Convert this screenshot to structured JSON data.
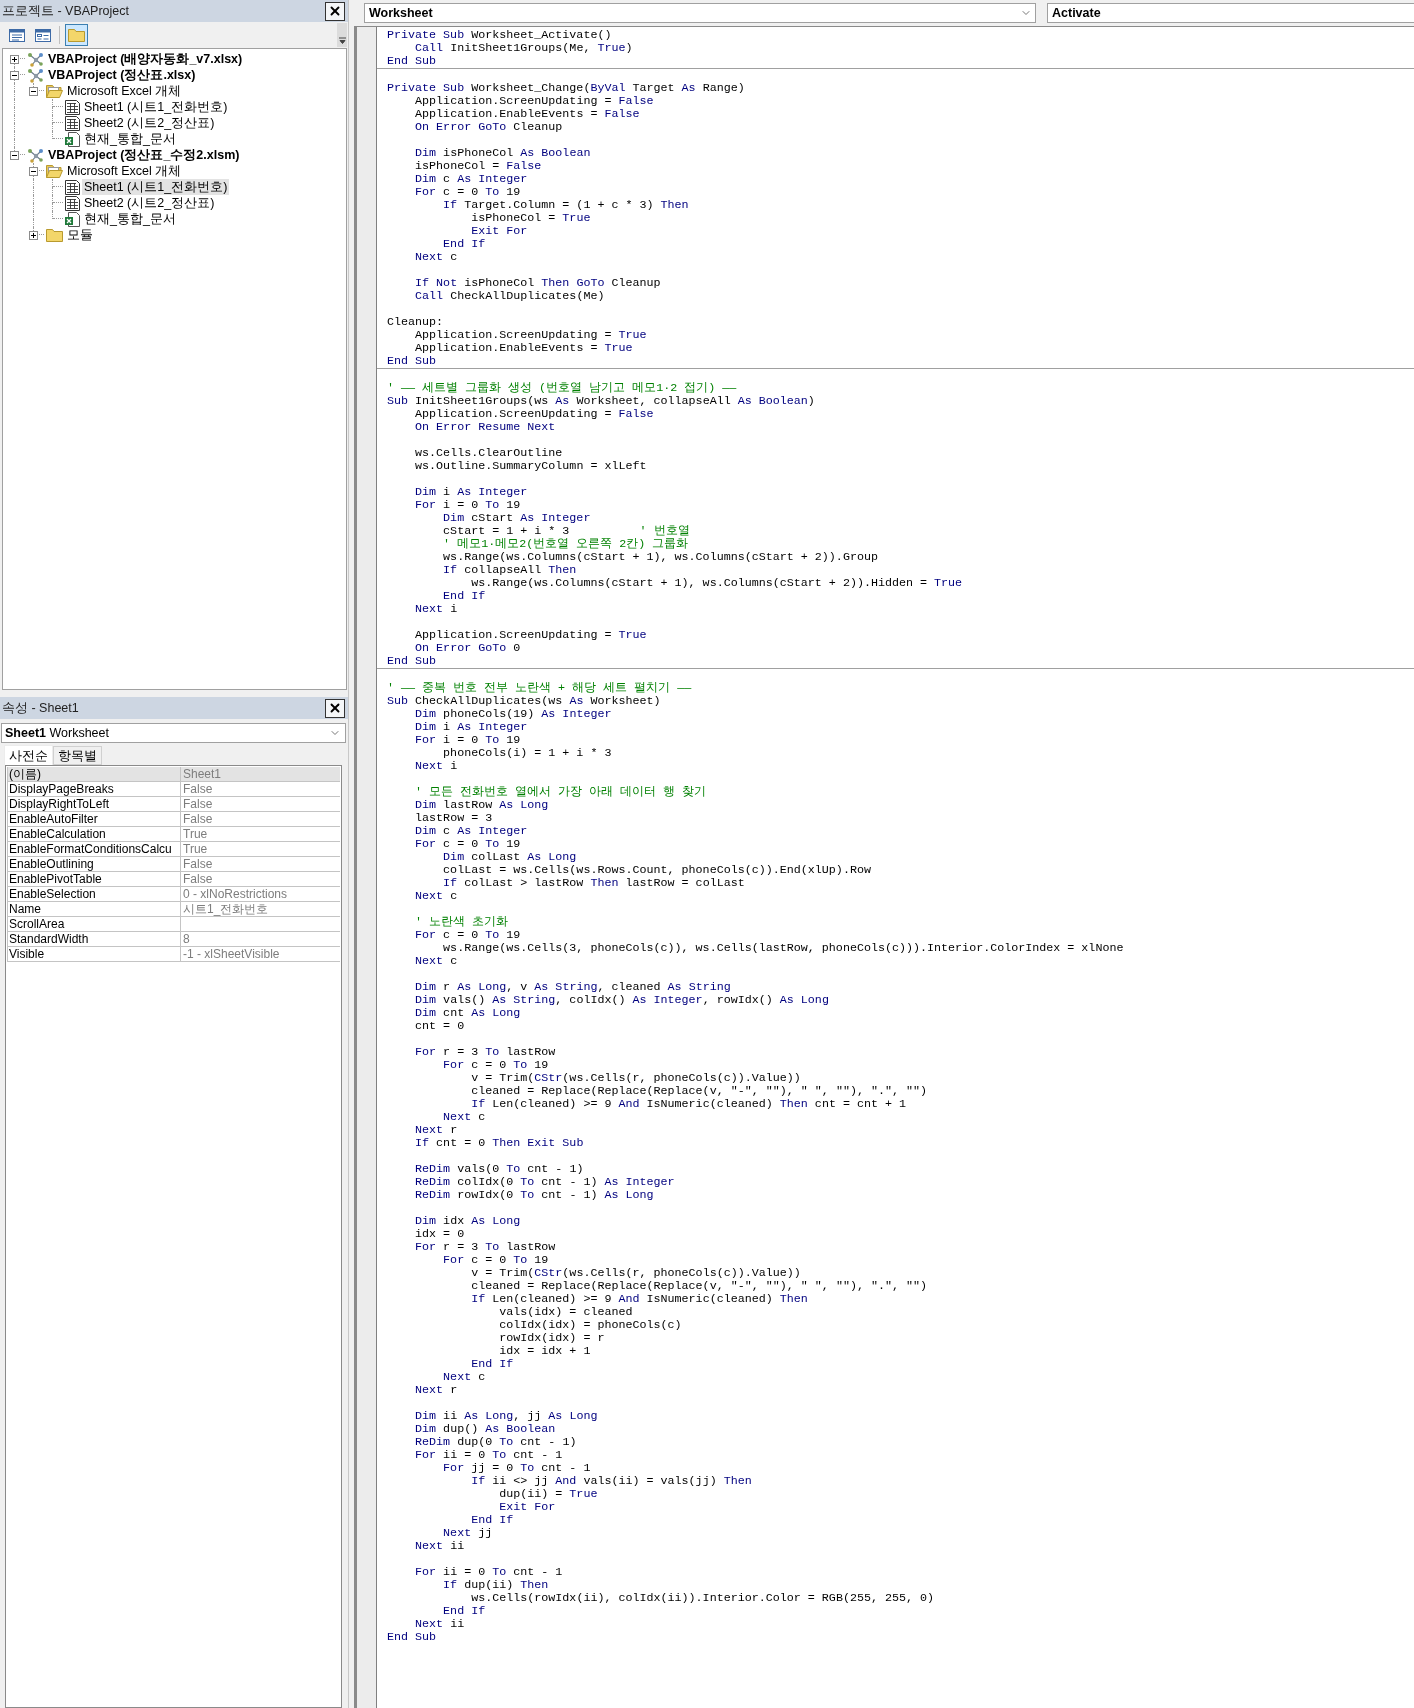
{
  "project_explorer": {
    "title": "프로젝트 - VBAProject",
    "toolbar": [
      {
        "kind": "view_code",
        "pressed": false
      },
      {
        "kind": "view_object",
        "pressed": false
      },
      {
        "kind": "toggle_folders",
        "pressed": true
      }
    ],
    "tree": [
      {
        "label": "VBAProject (배양자동화_v7.xlsx)",
        "kind": "project",
        "expanded": false,
        "selected": false
      },
      {
        "label": "VBAProject (정산표.xlsx)",
        "kind": "project",
        "expanded": true,
        "selected": false,
        "children": [
          {
            "label": "Microsoft Excel 개체",
            "kind": "folder",
            "expanded": true,
            "selected": false,
            "children": [
              {
                "label": "Sheet1 (시트1_전화번호)",
                "kind": "sheet",
                "selected": false
              },
              {
                "label": "Sheet2 (시트2_정산표)",
                "kind": "sheet",
                "selected": false
              },
              {
                "label": "현재_통합_문서",
                "kind": "workbook",
                "selected": false
              }
            ]
          }
        ]
      },
      {
        "label": "VBAProject (정산표_수정2.xlsm)",
        "kind": "project",
        "expanded": true,
        "selected": false,
        "children": [
          {
            "label": "Microsoft Excel 개체",
            "kind": "folder",
            "expanded": true,
            "selected": false,
            "children": [
              {
                "label": "Sheet1 (시트1_전화번호)",
                "kind": "sheet",
                "selected": true
              },
              {
                "label": "Sheet2 (시트2_정산표)",
                "kind": "sheet",
                "selected": false
              },
              {
                "label": "현재_통합_문서",
                "kind": "workbook",
                "selected": false
              }
            ]
          },
          {
            "label": "모듈",
            "kind": "folder",
            "expanded": false,
            "selected": false
          }
        ]
      }
    ]
  },
  "properties": {
    "title": "속성 - Sheet1",
    "object": {
      "name": "Sheet1",
      "type": "Worksheet"
    },
    "tabs": [
      {
        "label": "사전순",
        "selected": true
      },
      {
        "label": "항목별",
        "selected": false
      }
    ],
    "rows": [
      {
        "name": "(이름)",
        "value": "Sheet1",
        "selected": true
      },
      {
        "name": "DisplayPageBreaks",
        "value": "False",
        "selected": false
      },
      {
        "name": "DisplayRightToLeft",
        "value": "False",
        "selected": false
      },
      {
        "name": "EnableAutoFilter",
        "value": "False",
        "selected": false
      },
      {
        "name": "EnableCalculation",
        "value": "True",
        "selected": false
      },
      {
        "name": "EnableFormatConditionsCalcu",
        "value": "True",
        "selected": false
      },
      {
        "name": "EnableOutlining",
        "value": "False",
        "selected": false
      },
      {
        "name": "EnablePivotTable",
        "value": "False",
        "selected": false
      },
      {
        "name": "EnableSelection",
        "value": "0 - xlNoRestrictions",
        "selected": false
      },
      {
        "name": "Name",
        "value": "시트1_전화번호",
        "selected": false
      },
      {
        "name": "ScrollArea",
        "selected": false
      },
      {
        "name": "StandardWidth",
        "value": "8",
        "selected": false
      },
      {
        "name": "Visible",
        "value": "-1 - xlSheetVisible",
        "selected": false
      }
    ]
  },
  "code_window": {
    "object_box": "Worksheet",
    "procedure_box": "Activate",
    "procedures": [
      {
        "blocks": [
          [
            [
              {
                "kind": "keyword",
                "text": "Private Sub"
              },
              {
                "kind": "plain",
                "text": " Worksheet_Activate()"
              }
            ],
            [
              {
                "kind": "keyword",
                "text": "    Call"
              },
              {
                "kind": "plain",
                "text": " InitSheet1Groups(Me, "
              },
              {
                "kind": "keyword",
                "text": "True"
              },
              {
                "kind": "plain",
                "text": ")"
              }
            ],
            [
              {
                "kind": "keyword",
                "text": "End Sub"
              }
            ]
          ]
        ]
      },
      {
        "blocks": [
          [
            [
              {
                "kind": "keyword",
                "text": "Private Sub"
              },
              {
                "kind": "plain",
                "text": " Worksheet_Change("
              },
              {
                "kind": "keyword",
                "text": "ByVal"
              },
              {
                "kind": "plain",
                "text": " Target "
              },
              {
                "kind": "keyword",
                "text": "As"
              },
              {
                "kind": "plain",
                "text": " Range)"
              }
            ],
            [
              {
                "kind": "plain",
                "text": "    Application.ScreenUpdating = "
              },
              {
                "kind": "keyword",
                "text": "False"
              }
            ],
            [
              {
                "kind": "plain",
                "text": "    Application.EnableEvents = "
              },
              {
                "kind": "keyword",
                "text": "False"
              }
            ],
            [
              {
                "kind": "keyword",
                "text": "    On Error GoTo"
              },
              {
                "kind": "plain",
                "text": " Cleanup"
              }
            ]
          ],
          [
            [
              {
                "kind": "keyword",
                "text": "    Dim"
              },
              {
                "kind": "plain",
                "text": " isPhoneCol "
              },
              {
                "kind": "keyword",
                "text": "As Boolean"
              }
            ],
            [
              {
                "kind": "plain",
                "text": "    isPhoneCol = "
              },
              {
                "kind": "keyword",
                "text": "False"
              }
            ],
            [
              {
                "kind": "keyword",
                "text": "    Dim"
              },
              {
                "kind": "plain",
                "text": " c "
              },
              {
                "kind": "keyword",
                "text": "As Integer"
              }
            ],
            [
              {
                "kind": "keyword",
                "text": "    For"
              },
              {
                "kind": "plain",
                "text": " c = 0 "
              },
              {
                "kind": "keyword",
                "text": "To"
              },
              {
                "kind": "plain",
                "text": " 19"
              }
            ],
            [
              {
                "kind": "keyword",
                "text": "        If"
              },
              {
                "kind": "plain",
                "text": " Target.Column = (1 + c * 3) "
              },
              {
                "kind": "keyword",
                "text": "Then"
              }
            ],
            [
              {
                "kind": "plain",
                "text": "            isPhoneCol = "
              },
              {
                "kind": "keyword",
                "text": "True"
              }
            ],
            [
              {
                "kind": "keyword",
                "text": "            Exit For"
              }
            ],
            [
              {
                "kind": "keyword",
                "text": "        End If"
              }
            ],
            [
              {
                "kind": "keyword",
                "text": "    Next"
              },
              {
                "kind": "plain",
                "text": " c"
              }
            ]
          ],
          [
            [
              {
                "kind": "keyword",
                "text": "    If Not"
              },
              {
                "kind": "plain",
                "text": " isPhoneCol "
              },
              {
                "kind": "keyword",
                "text": "Then GoTo"
              },
              {
                "kind": "plain",
                "text": " Cleanup"
              }
            ],
            [
              {
                "kind": "keyword",
                "text": "    Call"
              },
              {
                "kind": "plain",
                "text": " CheckAllDuplicates(Me)"
              }
            ]
          ],
          [
            [
              {
                "kind": "plain",
                "text": "Cleanup:"
              }
            ],
            [
              {
                "kind": "plain",
                "text": "    Application.ScreenUpdating = "
              },
              {
                "kind": "keyword",
                "text": "True"
              }
            ],
            [
              {
                "kind": "plain",
                "text": "    Application.EnableEvents = "
              },
              {
                "kind": "keyword",
                "text": "True"
              }
            ],
            [
              {
                "kind": "keyword",
                "text": "End Sub"
              }
            ]
          ]
        ]
      },
      {
        "blocks": [
          [
            [
              {
                "kind": "comment",
                "text": "' —— 세트별 그룹화 생성 (번호열 남기고 메모1·2 접기) ——"
              }
            ],
            [
              {
                "kind": "keyword",
                "text": "Sub"
              },
              {
                "kind": "plain",
                "text": " InitSheet1Groups(ws "
              },
              {
                "kind": "keyword",
                "text": "As"
              },
              {
                "kind": "plain",
                "text": " Worksheet, collapseAll "
              },
              {
                "kind": "keyword",
                "text": "As Boolean"
              },
              {
                "kind": "plain",
                "text": ")"
              }
            ],
            [
              {
                "kind": "plain",
                "text": "    Application.ScreenUpdating = "
              },
              {
                "kind": "keyword",
                "text": "False"
              }
            ],
            [
              {
                "kind": "keyword",
                "text": "    On Error Resume Next"
              }
            ]
          ],
          [
            [
              {
                "kind": "plain",
                "text": "    ws.Cells.ClearOutline"
              }
            ],
            [
              {
                "kind": "plain",
                "text": "    ws.Outline.SummaryColumn = xlLeft"
              }
            ]
          ],
          [
            [
              {
                "kind": "keyword",
                "text": "    Dim"
              },
              {
                "kind": "plain",
                "text": " i "
              },
              {
                "kind": "keyword",
                "text": "As Integer"
              }
            ],
            [
              {
                "kind": "keyword",
                "text": "    For"
              },
              {
                "kind": "plain",
                "text": " i = 0 "
              },
              {
                "kind": "keyword",
                "text": "To"
              },
              {
                "kind": "plain",
                "text": " 19"
              }
            ],
            [
              {
                "kind": "keyword",
                "text": "        Dim"
              },
              {
                "kind": "plain",
                "text": " cStart "
              },
              {
                "kind": "keyword",
                "text": "As Integer"
              }
            ],
            [
              {
                "kind": "plain",
                "text": "        cStart = 1 + i * 3          "
              },
              {
                "kind": "comment",
                "text": "' 번호열"
              }
            ],
            [
              {
                "kind": "comment",
                "text": "        ' 메모1·메모2(번호열 오른쪽 2칸) 그룹화"
              }
            ],
            [
              {
                "kind": "plain",
                "text": "        ws.Range(ws.Columns(cStart + 1), ws.Columns(cStart + 2)).Group"
              }
            ],
            [
              {
                "kind": "keyword",
                "text": "        If"
              },
              {
                "kind": "plain",
                "text": " collapseAll "
              },
              {
                "kind": "keyword",
                "text": "Then"
              }
            ],
            [
              {
                "kind": "plain",
                "text": "            ws.Range(ws.Columns(cStart + 1), ws.Columns(cStart + 2)).Hidden = "
              },
              {
                "kind": "keyword",
                "text": "True"
              }
            ],
            [
              {
                "kind": "keyword",
                "text": "        End If"
              }
            ],
            [
              {
                "kind": "keyword",
                "text": "    Next"
              },
              {
                "kind": "plain",
                "text": " i"
              }
            ]
          ],
          [
            [
              {
                "kind": "plain",
                "text": "    Application.ScreenUpdating = "
              },
              {
                "kind": "keyword",
                "text": "True"
              }
            ],
            [
              {
                "kind": "keyword",
                "text": "    On Error GoTo"
              },
              {
                "kind": "plain",
                "text": " 0"
              }
            ],
            [
              {
                "kind": "keyword",
                "text": "End Sub"
              }
            ]
          ]
        ]
      },
      {
        "blocks": [
          [
            [
              {
                "kind": "comment",
                "text": "' —— 중복 번호 전부 노란색 + 해당 세트 펼치기 ——"
              }
            ],
            [
              {
                "kind": "keyword",
                "text": "Sub"
              },
              {
                "kind": "plain",
                "text": " CheckAllDuplicates(ws "
              },
              {
                "kind": "keyword",
                "text": "As"
              },
              {
                "kind": "plain",
                "text": " Worksheet)"
              }
            ],
            [
              {
                "kind": "keyword",
                "text": "    Dim"
              },
              {
                "kind": "plain",
                "text": " phoneCols(19) "
              },
              {
                "kind": "keyword",
                "text": "As Integer"
              }
            ],
            [
              {
                "kind": "keyword",
                "text": "    Dim"
              },
              {
                "kind": "plain",
                "text": " i "
              },
              {
                "kind": "keyword",
                "text": "As Integer"
              }
            ],
            [
              {
                "kind": "keyword",
                "text": "    For"
              },
              {
                "kind": "plain",
                "text": " i = 0 "
              },
              {
                "kind": "keyword",
                "text": "To"
              },
              {
                "kind": "plain",
                "text": " 19"
              }
            ],
            [
              {
                "kind": "plain",
                "text": "        phoneCols(i) = 1 + i * 3"
              }
            ],
            [
              {
                "kind": "keyword",
                "text": "    Next"
              },
              {
                "kind": "plain",
                "text": " i"
              }
            ]
          ],
          [
            [
              {
                "kind": "comment",
                "text": "    ' 모든 전화번호 열에서 가장 아래 데이터 행 찾기"
              }
            ],
            [
              {
                "kind": "keyword",
                "text": "    Dim"
              },
              {
                "kind": "plain",
                "text": " lastRow "
              },
              {
                "kind": "keyword",
                "text": "As Long"
              }
            ],
            [
              {
                "kind": "plain",
                "text": "    lastRow = 3"
              }
            ],
            [
              {
                "kind": "keyword",
                "text": "    Dim"
              },
              {
                "kind": "plain",
                "text": " c "
              },
              {
                "kind": "keyword",
                "text": "As Integer"
              }
            ],
            [
              {
                "kind": "keyword",
                "text": "    For"
              },
              {
                "kind": "plain",
                "text": " c = 0 "
              },
              {
                "kind": "keyword",
                "text": "To"
              },
              {
                "kind": "plain",
                "text": " 19"
              }
            ],
            [
              {
                "kind": "keyword",
                "text": "        Dim"
              },
              {
                "kind": "plain",
                "text": " colLast "
              },
              {
                "kind": "keyword",
                "text": "As Long"
              }
            ],
            [
              {
                "kind": "plain",
                "text": "        colLast = ws.Cells(ws.Rows.Count, phoneCols(c)).End(xlUp).Row"
              }
            ],
            [
              {
                "kind": "keyword",
                "text": "        If"
              },
              {
                "kind": "plain",
                "text": " colLast > lastRow "
              },
              {
                "kind": "keyword",
                "text": "Then"
              },
              {
                "kind": "plain",
                "text": " lastRow = colLast"
              }
            ],
            [
              {
                "kind": "keyword",
                "text": "    Next"
              },
              {
                "kind": "plain",
                "text": " c"
              }
            ]
          ],
          [
            [
              {
                "kind": "comment",
                "text": "    ' 노란색 초기화"
              }
            ],
            [
              {
                "kind": "keyword",
                "text": "    For"
              },
              {
                "kind": "plain",
                "text": " c = 0 "
              },
              {
                "kind": "keyword",
                "text": "To"
              },
              {
                "kind": "plain",
                "text": " 19"
              }
            ],
            [
              {
                "kind": "plain",
                "text": "        ws.Range(ws.Cells(3, phoneCols(c)), ws.Cells(lastRow, phoneCols(c))).Interior.ColorIndex = xlNone"
              }
            ],
            [
              {
                "kind": "keyword",
                "text": "    Next"
              },
              {
                "kind": "plain",
                "text": " c"
              }
            ]
          ],
          [
            [
              {
                "kind": "keyword",
                "text": "    Dim"
              },
              {
                "kind": "plain",
                "text": " r "
              },
              {
                "kind": "keyword",
                "text": "As Long"
              },
              {
                "kind": "plain",
                "text": ", v "
              },
              {
                "kind": "keyword",
                "text": "As String"
              },
              {
                "kind": "plain",
                "text": ", cleaned "
              },
              {
                "kind": "keyword",
                "text": "As String"
              }
            ],
            [
              {
                "kind": "keyword",
                "text": "    Dim"
              },
              {
                "kind": "plain",
                "text": " vals() "
              },
              {
                "kind": "keyword",
                "text": "As String"
              },
              {
                "kind": "plain",
                "text": ", colIdx() "
              },
              {
                "kind": "keyword",
                "text": "As Integer"
              },
              {
                "kind": "plain",
                "text": ", rowIdx() "
              },
              {
                "kind": "keyword",
                "text": "As Long"
              }
            ],
            [
              {
                "kind": "keyword",
                "text": "    Dim"
              },
              {
                "kind": "plain",
                "text": " cnt "
              },
              {
                "kind": "keyword",
                "text": "As Long"
              }
            ],
            [
              {
                "kind": "plain",
                "text": "    cnt = 0"
              }
            ]
          ],
          [
            [
              {
                "kind": "keyword",
                "text": "    For"
              },
              {
                "kind": "plain",
                "text": " r = 3 "
              },
              {
                "kind": "keyword",
                "text": "To"
              },
              {
                "kind": "plain",
                "text": " lastRow"
              }
            ],
            [
              {
                "kind": "keyword",
                "text": "        For"
              },
              {
                "kind": "plain",
                "text": " c = 0 "
              },
              {
                "kind": "keyword",
                "text": "To"
              },
              {
                "kind": "plain",
                "text": " 19"
              }
            ],
            [
              {
                "kind": "plain",
                "text": "            v = Trim("
              },
              {
                "kind": "keyword",
                "text": "CStr"
              },
              {
                "kind": "plain",
                "text": "(ws.Cells(r, phoneCols(c)).Value))"
              }
            ],
            [
              {
                "kind": "plain",
                "text": "            cleaned = Replace(Replace(Replace(v, \"-\", \"\"), \" \", \"\"), \".\", \"\")"
              }
            ],
            [
              {
                "kind": "keyword",
                "text": "            If"
              },
              {
                "kind": "plain",
                "text": " Len(cleaned) >= 9 "
              },
              {
                "kind": "keyword",
                "text": "And"
              },
              {
                "kind": "plain",
                "text": " IsNumeric(cleaned) "
              },
              {
                "kind": "keyword",
                "text": "Then"
              },
              {
                "kind": "plain",
                "text": " cnt = cnt + 1"
              }
            ],
            [
              {
                "kind": "keyword",
                "text": "        Next"
              },
              {
                "kind": "plain",
                "text": " c"
              }
            ],
            [
              {
                "kind": "keyword",
                "text": "    Next"
              },
              {
                "kind": "plain",
                "text": " r"
              }
            ],
            [
              {
                "kind": "keyword",
                "text": "    If"
              },
              {
                "kind": "plain",
                "text": " cnt = 0 "
              },
              {
                "kind": "keyword",
                "text": "Then Exit Sub"
              }
            ]
          ],
          [
            [
              {
                "kind": "keyword",
                "text": "    ReDim"
              },
              {
                "kind": "plain",
                "text": " vals(0 "
              },
              {
                "kind": "keyword",
                "text": "To"
              },
              {
                "kind": "plain",
                "text": " cnt - 1)"
              }
            ],
            [
              {
                "kind": "keyword",
                "text": "    ReDim"
              },
              {
                "kind": "plain",
                "text": " colIdx(0 "
              },
              {
                "kind": "keyword",
                "text": "To"
              },
              {
                "kind": "plain",
                "text": " cnt - 1) "
              },
              {
                "kind": "keyword",
                "text": "As Integer"
              }
            ],
            [
              {
                "kind": "keyword",
                "text": "    ReDim"
              },
              {
                "kind": "plain",
                "text": " rowIdx(0 "
              },
              {
                "kind": "keyword",
                "text": "To"
              },
              {
                "kind": "plain",
                "text": " cnt - 1) "
              },
              {
                "kind": "keyword",
                "text": "As Long"
              }
            ]
          ],
          [
            [
              {
                "kind": "keyword",
                "text": "    Dim"
              },
              {
                "kind": "plain",
                "text": " idx "
              },
              {
                "kind": "keyword",
                "text": "As Long"
              }
            ],
            [
              {
                "kind": "plain",
                "text": "    idx = 0"
              }
            ],
            [
              {
                "kind": "keyword",
                "text": "    For"
              },
              {
                "kind": "plain",
                "text": " r = 3 "
              },
              {
                "kind": "keyword",
                "text": "To"
              },
              {
                "kind": "plain",
                "text": " lastRow"
              }
            ],
            [
              {
                "kind": "keyword",
                "text": "        For"
              },
              {
                "kind": "plain",
                "text": " c = 0 "
              },
              {
                "kind": "keyword",
                "text": "To"
              },
              {
                "kind": "plain",
                "text": " 19"
              }
            ],
            [
              {
                "kind": "plain",
                "text": "            v = Trim("
              },
              {
                "kind": "keyword",
                "text": "CStr"
              },
              {
                "kind": "plain",
                "text": "(ws.Cells(r, phoneCols(c)).Value))"
              }
            ],
            [
              {
                "kind": "plain",
                "text": "            cleaned = Replace(Replace(Replace(v, \"-\", \"\"), \" \", \"\"), \".\", \"\")"
              }
            ],
            [
              {
                "kind": "keyword",
                "text": "            If"
              },
              {
                "kind": "plain",
                "text": " Len(cleaned) >= 9 "
              },
              {
                "kind": "keyword",
                "text": "And"
              },
              {
                "kind": "plain",
                "text": " IsNumeric(cleaned) "
              },
              {
                "kind": "keyword",
                "text": "Then"
              }
            ],
            [
              {
                "kind": "plain",
                "text": "                vals(idx) = cleaned"
              }
            ],
            [
              {
                "kind": "plain",
                "text": "                colIdx(idx) = phoneCols(c)"
              }
            ],
            [
              {
                "kind": "plain",
                "text": "                rowIdx(idx) = r"
              }
            ],
            [
              {
                "kind": "plain",
                "text": "                idx = idx + 1"
              }
            ],
            [
              {
                "kind": "keyword",
                "text": "            End If"
              }
            ],
            [
              {
                "kind": "keyword",
                "text": "        Next"
              },
              {
                "kind": "plain",
                "text": " c"
              }
            ],
            [
              {
                "kind": "keyword",
                "text": "    Next"
              },
              {
                "kind": "plain",
                "text": " r"
              }
            ]
          ],
          [
            [
              {
                "kind": "keyword",
                "text": "    Dim"
              },
              {
                "kind": "plain",
                "text": " ii "
              },
              {
                "kind": "keyword",
                "text": "As Long"
              },
              {
                "kind": "plain",
                "text": ", jj "
              },
              {
                "kind": "keyword",
                "text": "As Long"
              }
            ],
            [
              {
                "kind": "keyword",
                "text": "    Dim"
              },
              {
                "kind": "plain",
                "text": " dup() "
              },
              {
                "kind": "keyword",
                "text": "As Boolean"
              }
            ],
            [
              {
                "kind": "keyword",
                "text": "    ReDim"
              },
              {
                "kind": "plain",
                "text": " dup(0 "
              },
              {
                "kind": "keyword",
                "text": "To"
              },
              {
                "kind": "plain",
                "text": " cnt - 1)"
              }
            ],
            [
              {
                "kind": "keyword",
                "text": "    For"
              },
              {
                "kind": "plain",
                "text": " ii = 0 "
              },
              {
                "kind": "keyword",
                "text": "To"
              },
              {
                "kind": "plain",
                "text": " cnt - 1"
              }
            ],
            [
              {
                "kind": "keyword",
                "text": "        For"
              },
              {
                "kind": "plain",
                "text": " jj = 0 "
              },
              {
                "kind": "keyword",
                "text": "To"
              },
              {
                "kind": "plain",
                "text": " cnt - 1"
              }
            ],
            [
              {
                "kind": "keyword",
                "text": "            If"
              },
              {
                "kind": "plain",
                "text": " ii <> jj "
              },
              {
                "kind": "keyword",
                "text": "And"
              },
              {
                "kind": "plain",
                "text": " vals(ii) = vals(jj) "
              },
              {
                "kind": "keyword",
                "text": "Then"
              }
            ],
            [
              {
                "kind": "plain",
                "text": "                dup(ii) = "
              },
              {
                "kind": "keyword",
                "text": "True"
              }
            ],
            [
              {
                "kind": "keyword",
                "text": "                Exit For"
              }
            ],
            [
              {
                "kind": "keyword",
                "text": "            End If"
              }
            ],
            [
              {
                "kind": "keyword",
                "text": "        Next"
              },
              {
                "kind": "plain",
                "text": " jj"
              }
            ],
            [
              {
                "kind": "keyword",
                "text": "    Next"
              },
              {
                "kind": "plain",
                "text": " ii"
              }
            ]
          ],
          [
            [
              {
                "kind": "keyword",
                "text": "    For"
              },
              {
                "kind": "plain",
                "text": " ii = 0 "
              },
              {
                "kind": "keyword",
                "text": "To"
              },
              {
                "kind": "plain",
                "text": " cnt - 1"
              }
            ],
            [
              {
                "kind": "keyword",
                "text": "        If"
              },
              {
                "kind": "plain",
                "text": " dup(ii) "
              },
              {
                "kind": "keyword",
                "text": "Then"
              }
            ],
            [
              {
                "kind": "plain",
                "text": "            ws.Cells(rowIdx(ii), colIdx(ii)).Interior.Color = RGB(255, 255, 0)"
              }
            ],
            [
              {
                "kind": "keyword",
                "text": "        End If"
              }
            ],
            [
              {
                "kind": "keyword",
                "text": "    Next"
              },
              {
                "kind": "plain",
                "text": " ii"
              }
            ],
            [
              {
                "kind": "keyword",
                "text": "End Sub"
              }
            ]
          ]
        ]
      }
    ]
  }
}
